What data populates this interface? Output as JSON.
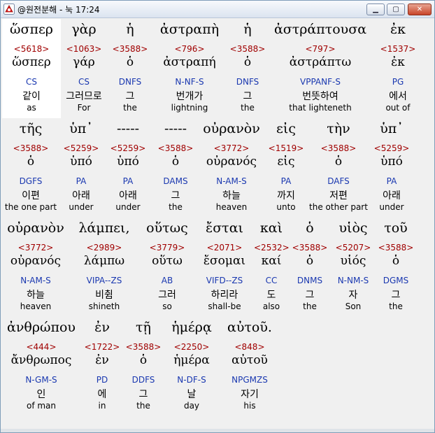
{
  "window": {
    "title": "@원전분해 - 눅 17:24",
    "min_label": "▁",
    "max_label": "▢",
    "close_label": "✕"
  },
  "rows": [
    [
      {
        "g": "ὥσπερ",
        "s": "<5618>",
        "l": "ὥσπερ",
        "m": "CS",
        "k": "같이",
        "e": "as"
      },
      {
        "g": "γὰρ",
        "s": "<1063>",
        "l": "γάρ",
        "m": "CS",
        "k": "그러므로",
        "e": "For"
      },
      {
        "g": "ἡ",
        "s": "<3588>",
        "l": "ὁ",
        "m": "DNFS",
        "k": "그",
        "e": "the"
      },
      {
        "g": "ἀστραπὴ",
        "s": "<796>",
        "l": "ἀστραπή",
        "m": "N-NF-S",
        "k": "번개가",
        "e": "lightning"
      },
      {
        "g": "ἡ",
        "s": "<3588>",
        "l": "ὁ",
        "m": "DNFS",
        "k": "그",
        "e": "the"
      },
      {
        "g": "ἀστράπτουσα",
        "s": "<797>",
        "l": "ἀστράπτω",
        "m": "VPPANF-S",
        "k": "번뜻하여",
        "e": "that lighteneth"
      },
      {
        "g": "ἐκ",
        "s": "<1537>",
        "l": "ἐκ",
        "m": "PG",
        "k": "에서",
        "e": "out of"
      }
    ],
    [
      {
        "g": "τῆς",
        "s": "<3588>",
        "l": "ὁ",
        "m": "DGFS",
        "k": "이편",
        "e": "the one part"
      },
      {
        "g": "ὑπ᾽",
        "s": "<5259>",
        "l": "ὑπό",
        "m": "PA",
        "k": "아래",
        "e": "under"
      },
      {
        "g": "-----",
        "s": "<5259>",
        "l": "ὑπό",
        "m": "PA",
        "k": "아래",
        "e": "under"
      },
      {
        "g": "-----",
        "s": "<3588>",
        "l": "ὁ",
        "m": "DAMS",
        "k": "그",
        "e": "the"
      },
      {
        "g": "οὐρανὸν",
        "s": "<3772>",
        "l": "οὐρανός",
        "m": "N-AM-S",
        "k": "하늘",
        "e": "heaven"
      },
      {
        "g": "εἰς",
        "s": "<1519>",
        "l": "εἰς",
        "m": "PA",
        "k": "까지",
        "e": "unto"
      },
      {
        "g": "τὴν",
        "s": "<3588>",
        "l": "ὁ",
        "m": "DAFS",
        "k": "저편",
        "e": "the other part"
      },
      {
        "g": "ὑπ᾽",
        "s": "<5259>",
        "l": "ὑπό",
        "m": "PA",
        "k": "아래",
        "e": "under"
      }
    ],
    [
      {
        "g": "οὐρανὸν",
        "s": "<3772>",
        "l": "οὐρανός",
        "m": "N-AM-S",
        "k": "하늘",
        "e": "heaven"
      },
      {
        "g": "λάμπει,",
        "s": "<2989>",
        "l": "λάμπω",
        "m": "VIPA--ZS",
        "k": "비췸",
        "e": "shineth"
      },
      {
        "g": "οὕτως",
        "s": "<3779>",
        "l": "οὕτω",
        "m": "AB",
        "k": "그러",
        "e": "so"
      },
      {
        "g": "ἔσται",
        "s": "<2071>",
        "l": "ἔσομαι",
        "m": "VIFD--ZS",
        "k": "하리라",
        "e": "shall-be"
      },
      {
        "g": "καὶ",
        "s": "<2532>",
        "l": "καί",
        "m": "CC",
        "k": "도",
        "e": "also"
      },
      {
        "g": "ὁ",
        "s": "<3588>",
        "l": "ὁ",
        "m": "DNMS",
        "k": "그",
        "e": "the"
      },
      {
        "g": "υἱὸς",
        "s": "<5207>",
        "l": "υἱός",
        "m": "N-NM-S",
        "k": "자",
        "e": "Son"
      },
      {
        "g": "τοῦ",
        "s": "<3588>",
        "l": "ὁ",
        "m": "DGMS",
        "k": "그",
        "e": "the"
      }
    ],
    [
      {
        "g": "ἀνθρώπου",
        "s": "<444>",
        "l": "ἄνθρωπος",
        "m": "N-GM-S",
        "k": "인",
        "e": "of man"
      },
      {
        "g": "ἐν",
        "s": "<1722>",
        "l": "ἐν",
        "m": "PD",
        "k": "에",
        "e": "in"
      },
      {
        "g": "τῇ",
        "s": "<3588>",
        "l": "ὁ",
        "m": "DDFS",
        "k": "그",
        "e": "the"
      },
      {
        "g": "ἡμέρᾳ",
        "s": "<2250>",
        "l": "ἡμέρα",
        "m": "N-DF-S",
        "k": "날",
        "e": "day"
      },
      {
        "g": "αὐτοῦ.",
        "s": "<848>",
        "l": "αὐτοῦ",
        "m": "NPGMZS",
        "k": "자기",
        "e": "his"
      }
    ]
  ]
}
